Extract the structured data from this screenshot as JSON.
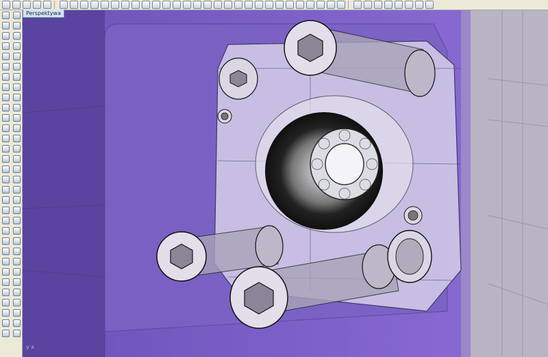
{
  "viewport": {
    "tab_label": "Perspektywa"
  },
  "axis": {
    "x_label": "x",
    "y_label": "y"
  },
  "colors": {
    "background": "#6a4fb3",
    "part": "#cfc6e6",
    "right_panel": "#b9b4c4"
  }
}
